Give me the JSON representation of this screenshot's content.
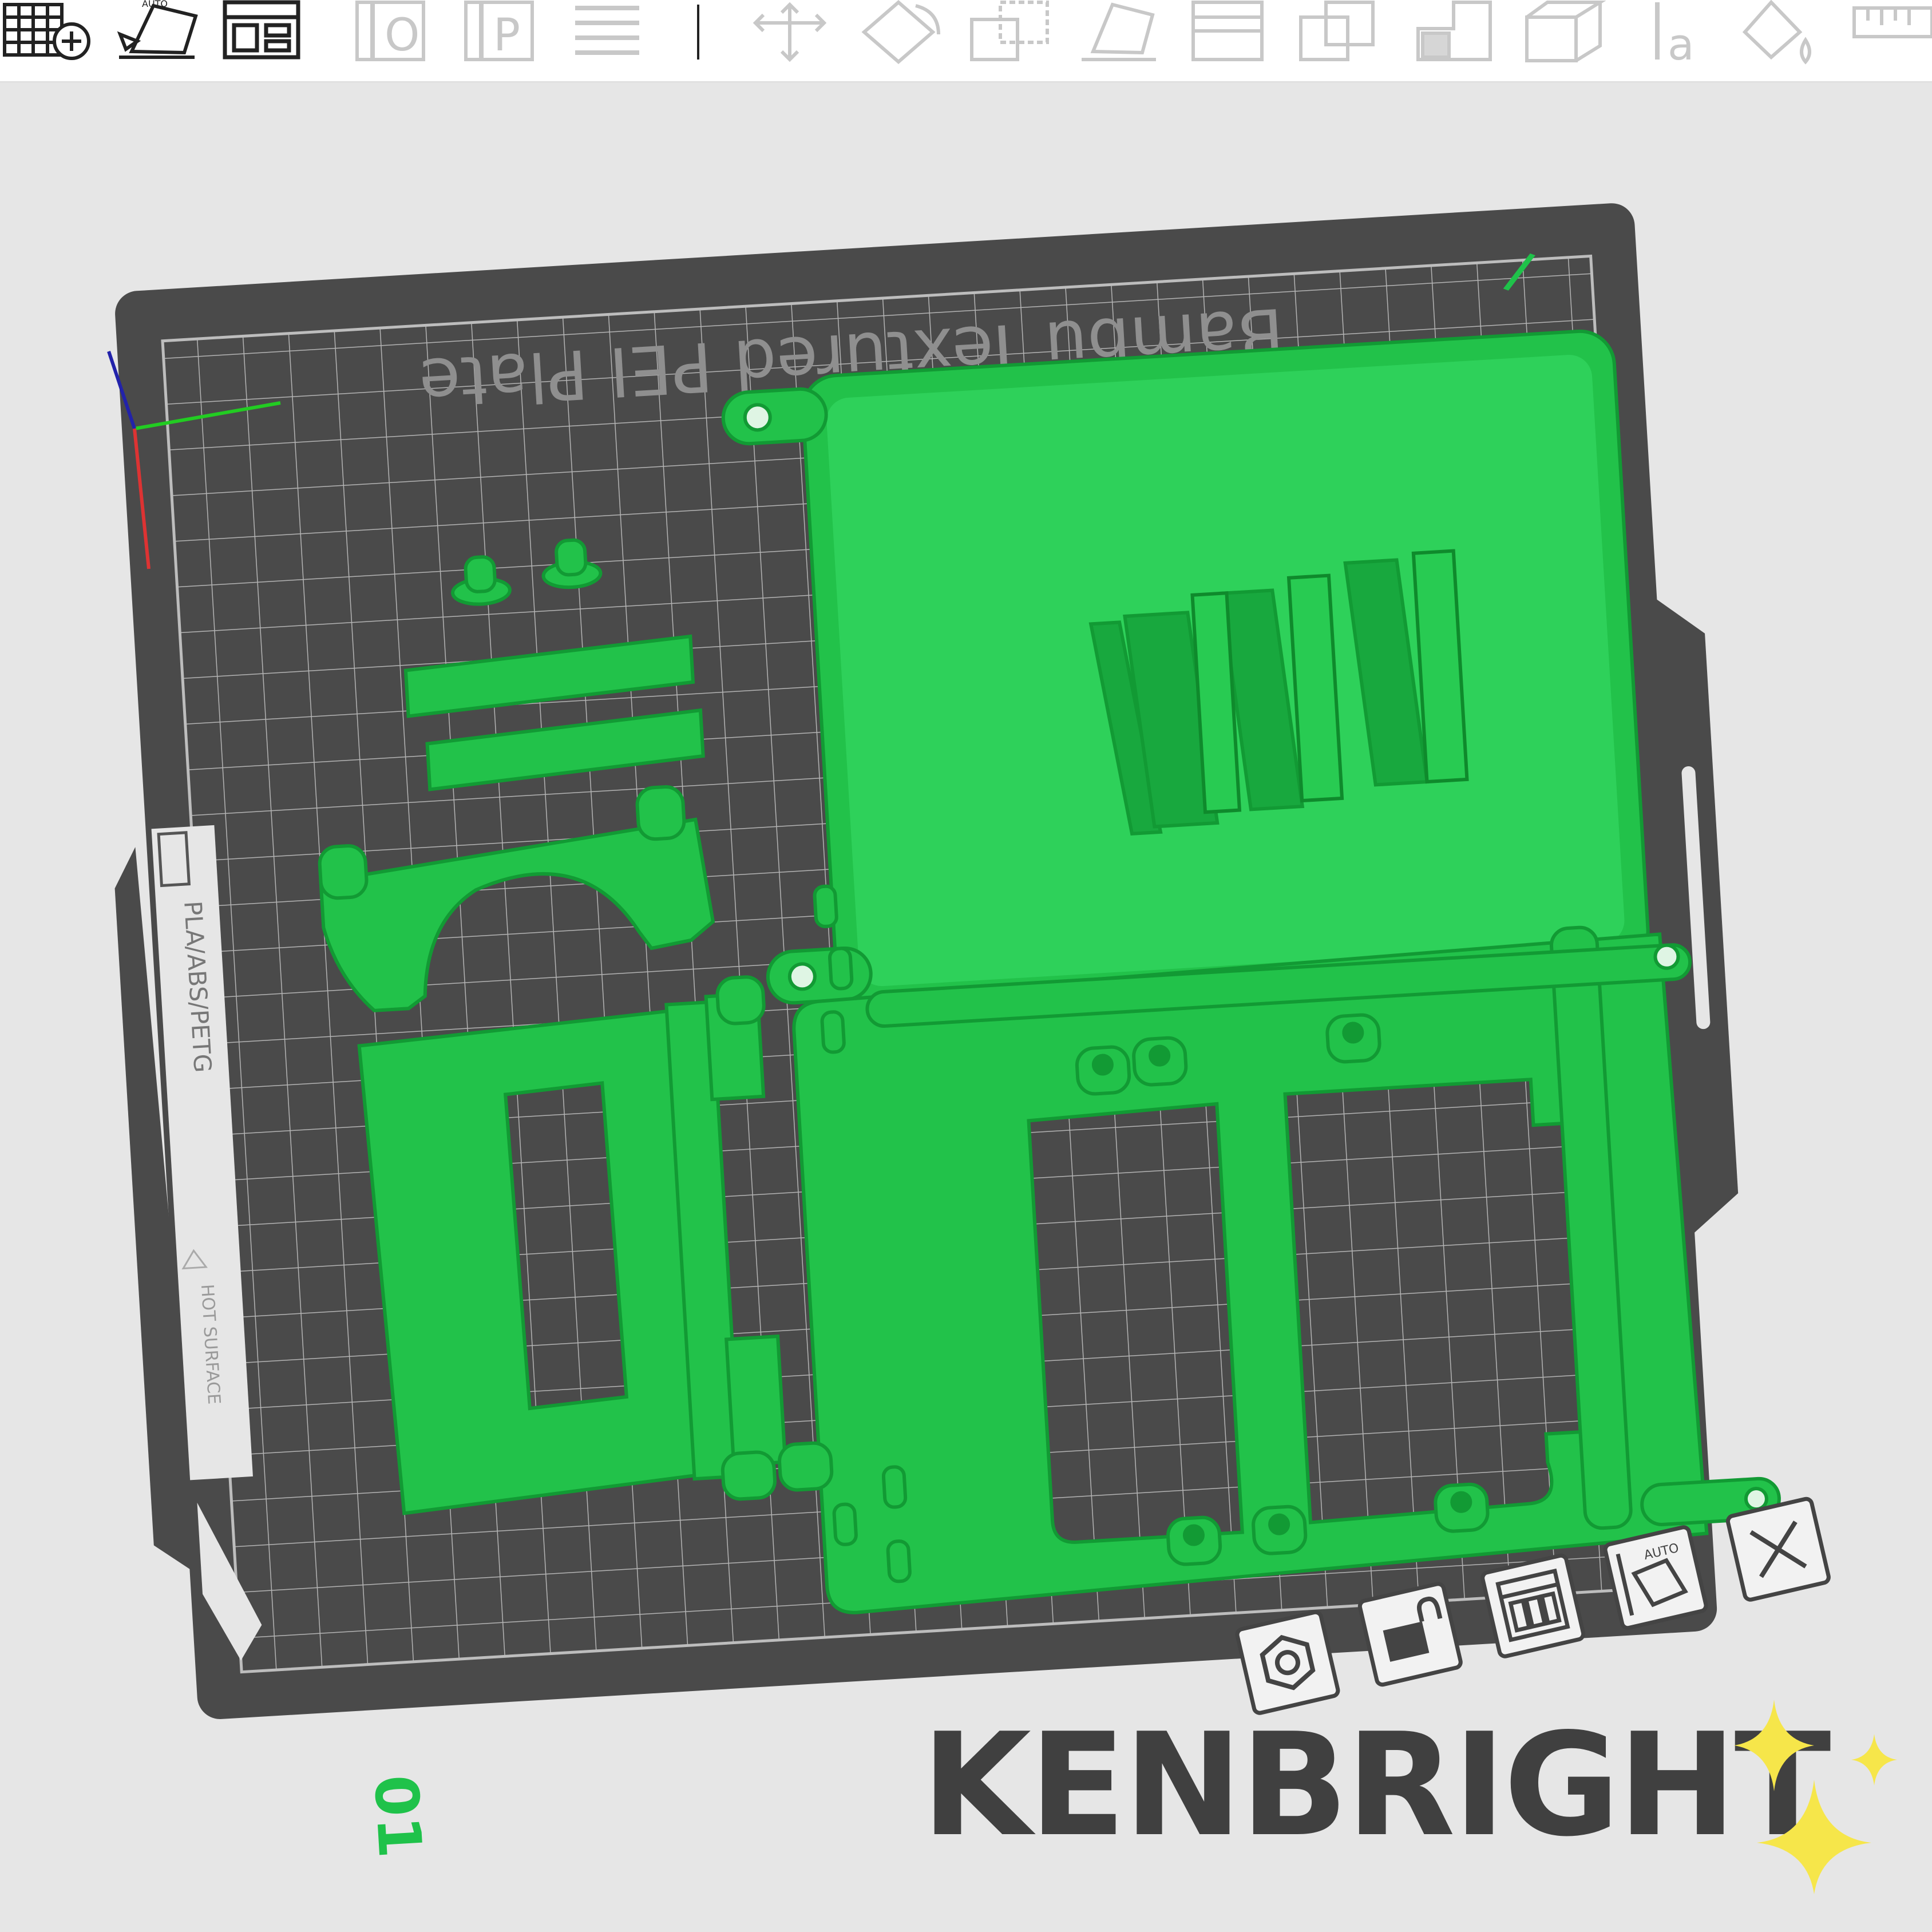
{
  "toolbar": {
    "buttons": [
      {
        "name": "add-plate-button",
        "icon": "grid-plus-icon",
        "enabled": true
      },
      {
        "name": "auto-orient-button",
        "icon": "auto-orient-icon",
        "icon_text": "AUTO",
        "enabled": true
      },
      {
        "name": "arrange-button",
        "icon": "arrange-icon",
        "enabled": true
      },
      {
        "name": "object-button",
        "icon": "object-o-icon",
        "icon_text": "O",
        "enabled": false
      },
      {
        "name": "part-button",
        "icon": "part-p-icon",
        "icon_text": "P",
        "enabled": false
      },
      {
        "name": "layers-button",
        "icon": "layers-icon",
        "enabled": false
      },
      {
        "name": "move-button",
        "icon": "move-icon",
        "enabled": false
      },
      {
        "name": "rotate-button",
        "icon": "rotate-icon",
        "enabled": false
      },
      {
        "name": "scale-button",
        "icon": "scale-icon",
        "enabled": false
      },
      {
        "name": "lay-on-face-button",
        "icon": "lay-on-face-icon",
        "enabled": false
      },
      {
        "name": "cut-button",
        "icon": "cut-icon",
        "enabled": false
      },
      {
        "name": "boolean-button",
        "icon": "boolean-icon",
        "enabled": false
      },
      {
        "name": "support-paint-button",
        "icon": "support-paint-icon",
        "enabled": false
      },
      {
        "name": "seam-paint-button",
        "icon": "seam-paint-icon",
        "enabled": false
      },
      {
        "name": "text-button",
        "icon": "text-icon",
        "icon_text": "a",
        "enabled": false
      },
      {
        "name": "color-paint-button",
        "icon": "color-paint-icon",
        "enabled": false
      },
      {
        "name": "measure-button",
        "icon": "measure-icon",
        "enabled": false
      }
    ]
  },
  "plate": {
    "label": "Bambu Textured PEI Plate",
    "number": "01",
    "side_label_material": "PLA/ABS/PETG",
    "side_label_warning": "HOT SURFACE",
    "colors": {
      "background": "#e6e6e6",
      "plate": "#4a4a4a",
      "grid": "#b9b9b9",
      "plate_text": "#8a8a8a",
      "model": "#22c24a",
      "model_dark": "#129a34",
      "plate_number": "#1fc24a",
      "axis_x": "#d33",
      "axis_y": "#2c2",
      "axis_z": "#22a"
    }
  },
  "plate_controls": [
    {
      "name": "plate-settings-button",
      "icon": "hex-nut-icon"
    },
    {
      "name": "lock-plate-button",
      "icon": "lock-icon"
    },
    {
      "name": "arrange-plate-button",
      "icon": "arrange-icon"
    },
    {
      "name": "auto-orient-plate-button",
      "icon": "auto-orient-icon",
      "icon_text": "AUTO"
    },
    {
      "name": "delete-plate-button",
      "icon": "close-icon"
    }
  ],
  "brand": {
    "text": "KENBRIGHT",
    "icon": "sparkles-icon",
    "sparkle_color": "#f6e64a"
  }
}
